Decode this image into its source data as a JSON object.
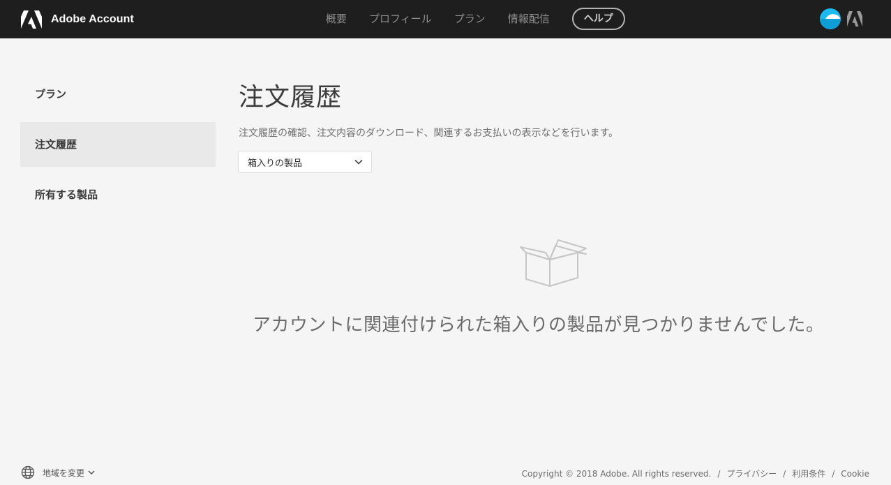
{
  "header": {
    "brand": "Adobe Account",
    "nav": [
      "概要",
      "プロフィール",
      "プラン",
      "情報配信"
    ],
    "help": "ヘルプ"
  },
  "sidebar": {
    "items": [
      {
        "label": "プラン",
        "active": false
      },
      {
        "label": "注文履歴",
        "active": true
      },
      {
        "label": "所有する製品",
        "active": false
      }
    ]
  },
  "main": {
    "title": "注文履歴",
    "description": "注文履歴の確認、注文内容のダウンロード、関連するお支払いの表示などを行います。",
    "filter_selected": "箱入りの製品",
    "empty_message": "アカウントに関連付けられた箱入りの製品が見つかりませんでした。"
  },
  "footer": {
    "region_label": "地域を変更",
    "copyright": "Copyright © 2018 Adobe. All rights reserved.",
    "links": [
      "プライバシー",
      "利用条件",
      "Cookie"
    ]
  },
  "colors": {
    "header_bg": "#1e1e1e",
    "page_bg": "#f5f5f5",
    "avatar": "#1ab9f0",
    "active_item_bg": "#e9e9e9"
  }
}
